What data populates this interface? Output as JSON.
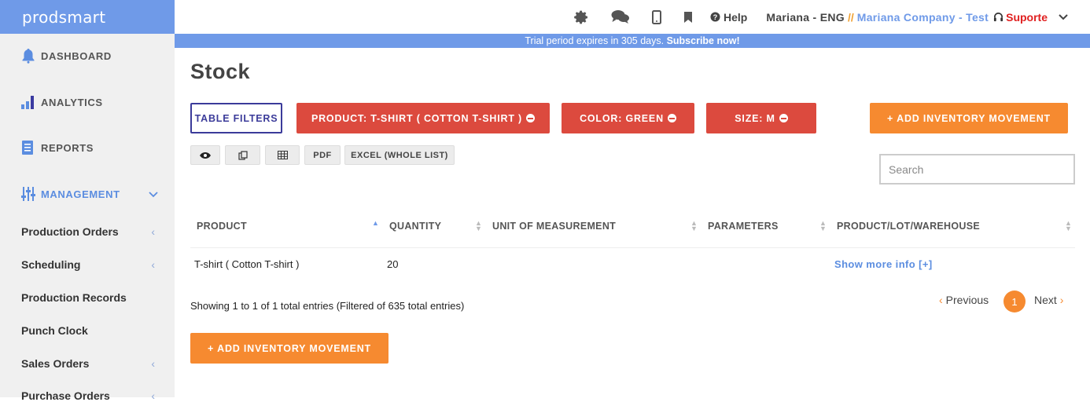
{
  "app": {
    "logo": "prodsmart"
  },
  "sidebar": {
    "main_items": [
      {
        "label": "DASHBOARD",
        "icon": "bell-icon"
      },
      {
        "label": "ANALYTICS",
        "icon": "bar-chart-icon"
      },
      {
        "label": "REPORTS",
        "icon": "document-icon"
      },
      {
        "label": "MANAGEMENT",
        "icon": "sliders-icon",
        "active": true
      }
    ],
    "sub_items": [
      {
        "label": "Production Orders",
        "expandable": true
      },
      {
        "label": "Scheduling",
        "expandable": true
      },
      {
        "label": "Production Records",
        "expandable": false
      },
      {
        "label": "Punch Clock",
        "expandable": false
      },
      {
        "label": "Sales Orders",
        "expandable": true
      },
      {
        "label": "Purchase Orders",
        "expandable": true
      }
    ]
  },
  "topbar": {
    "icons": [
      "gear-icon",
      "chat-icon",
      "mobile-icon",
      "bookmark-icon"
    ],
    "help": "Help",
    "user": "Mariana - ENG",
    "separator": "//",
    "company": "Mariana Company - Test",
    "support": "Suporte"
  },
  "trial": {
    "text": "Trial period expires in 305 days.",
    "link": "Subscribe now!"
  },
  "page": {
    "title": "Stock"
  },
  "filters": {
    "table_filters": "TABLE FILTERS",
    "product": "PRODUCT: T-SHIRT ( COTTON T-SHIRT )",
    "color": "COLOR: GREEN",
    "size": "SIZE: M"
  },
  "actions": {
    "add_movement": "ADD INVENTORY MOVEMENT"
  },
  "tools": {
    "pdf": "PDF",
    "excel": "EXCEL (WHOLE LIST)"
  },
  "search": {
    "placeholder": "Search",
    "value": ""
  },
  "table": {
    "columns": [
      "PRODUCT",
      "QUANTITY",
      "UNIT OF MEASUREMENT",
      "PARAMETERS",
      "PRODUCT/LOT/WAREHOUSE"
    ],
    "rows": [
      {
        "product": "T-shirt ( Cotton T-shirt )",
        "quantity": "20",
        "unit": "",
        "parameters": "",
        "link": "Show more info [+]"
      }
    ]
  },
  "footer": {
    "info": "Showing 1 to 1 of 1 total entries (Filtered of 635 total entries)"
  },
  "pagination": {
    "previous": "Previous",
    "current": "1",
    "next": "Next"
  },
  "colors": {
    "brand_blue": "#6f9ae8",
    "accent_orange": "#f68a30",
    "filter_red": "#dc4a3e",
    "outline_navy": "#3b3b9a"
  }
}
